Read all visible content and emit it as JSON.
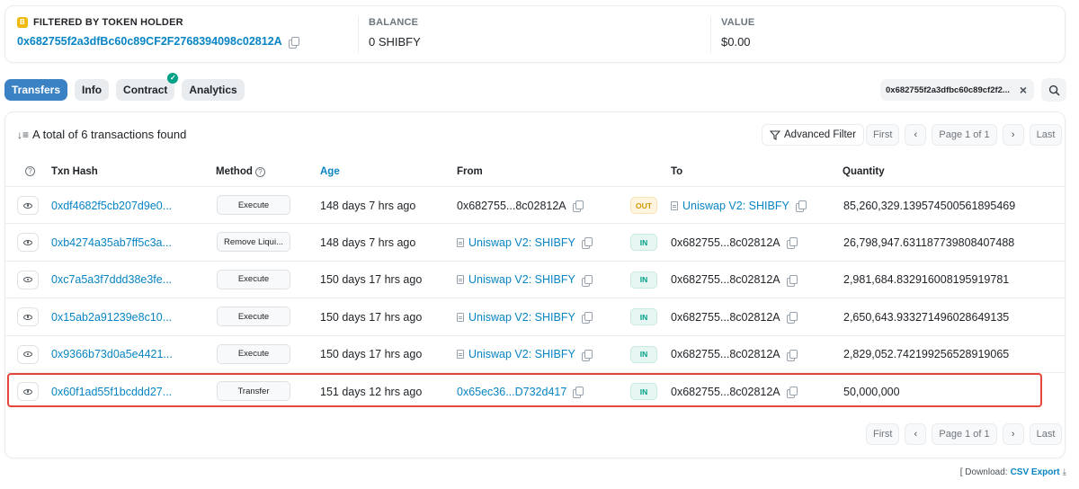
{
  "summary": {
    "filter_label": "FILTERED BY TOKEN HOLDER",
    "token_letter": "B",
    "holder_address": "0x682755f2a3dfBc60c89CF2F2768394098c02812A",
    "balance_label": "BALANCE",
    "balance_value": "0 SHIBFY",
    "value_label": "VALUE",
    "value_value": "$0.00"
  },
  "tabs": [
    {
      "label": "Transfers",
      "active": true
    },
    {
      "label": "Info",
      "active": false
    },
    {
      "label": "Contract",
      "active": false,
      "verified": true
    },
    {
      "label": "Analytics",
      "active": false
    }
  ],
  "filter_chip": {
    "text": "0x682755f2a3dfbc60c89cf2f2...",
    "close": "×"
  },
  "table": {
    "total_text": "A total of 6 transactions found",
    "advanced_filter": "Advanced Filter",
    "pager": {
      "first": "First",
      "prev": "‹",
      "page": "Page 1 of 1",
      "next": "›",
      "last": "Last"
    },
    "headers": {
      "txn_hash": "Txn Hash",
      "method": "Method",
      "age": "Age",
      "from": "From",
      "to": "To",
      "quantity": "Quantity"
    },
    "rows": [
      {
        "hash": "0xdf4682f5cb207d9e0...",
        "method": "Execute",
        "age": "148 days 7 hrs ago",
        "from": "0x682755...8c02812A",
        "from_contract": false,
        "dir": "OUT",
        "to": "Uniswap V2: SHIBFY",
        "to_contract": true,
        "quantity": "85,260,329.139574500561895469"
      },
      {
        "hash": "0xb4274a35ab7ff5c3a...",
        "method": "Remove Liqui...",
        "age": "148 days 7 hrs ago",
        "from": "Uniswap V2: SHIBFY",
        "from_contract": true,
        "dir": "IN",
        "to": "0x682755...8c02812A",
        "to_contract": false,
        "quantity": "26,798,947.631187739808407488"
      },
      {
        "hash": "0xc7a5a3f7ddd38e3fe...",
        "method": "Execute",
        "age": "150 days 17 hrs ago",
        "from": "Uniswap V2: SHIBFY",
        "from_contract": true,
        "dir": "IN",
        "to": "0x682755...8c02812A",
        "to_contract": false,
        "quantity": "2,981,684.832916008195919781"
      },
      {
        "hash": "0x15ab2a91239e8c10...",
        "method": "Execute",
        "age": "150 days 17 hrs ago",
        "from": "Uniswap V2: SHIBFY",
        "from_contract": true,
        "dir": "IN",
        "to": "0x682755...8c02812A",
        "to_contract": false,
        "quantity": "2,650,643.933271496028649135"
      },
      {
        "hash": "0x9366b73d0a5e4421...",
        "method": "Execute",
        "age": "150 days 17 hrs ago",
        "from": "Uniswap V2: SHIBFY",
        "from_contract": true,
        "dir": "IN",
        "to": "0x682755...8c02812A",
        "to_contract": false,
        "quantity": "2,829,052.742199256528919065"
      },
      {
        "hash": "0x60f1ad55f1bcddd27...",
        "method": "Transfer",
        "age": "151 days 12 hrs ago",
        "from": "0x65ec36...D732d417",
        "from_contract": false,
        "from_link": true,
        "dir": "IN",
        "to": "0x682755...8c02812A",
        "to_contract": false,
        "quantity": "50,000,000"
      }
    ]
  },
  "footer": {
    "download_label": "[ Download:",
    "csv_export": "CSV Export"
  },
  "colors": {
    "accent": "#0784c3",
    "active_tab": "#3b82c4",
    "highlight": "#e5463c",
    "in": "#00a186",
    "out": "#cc9a06"
  }
}
